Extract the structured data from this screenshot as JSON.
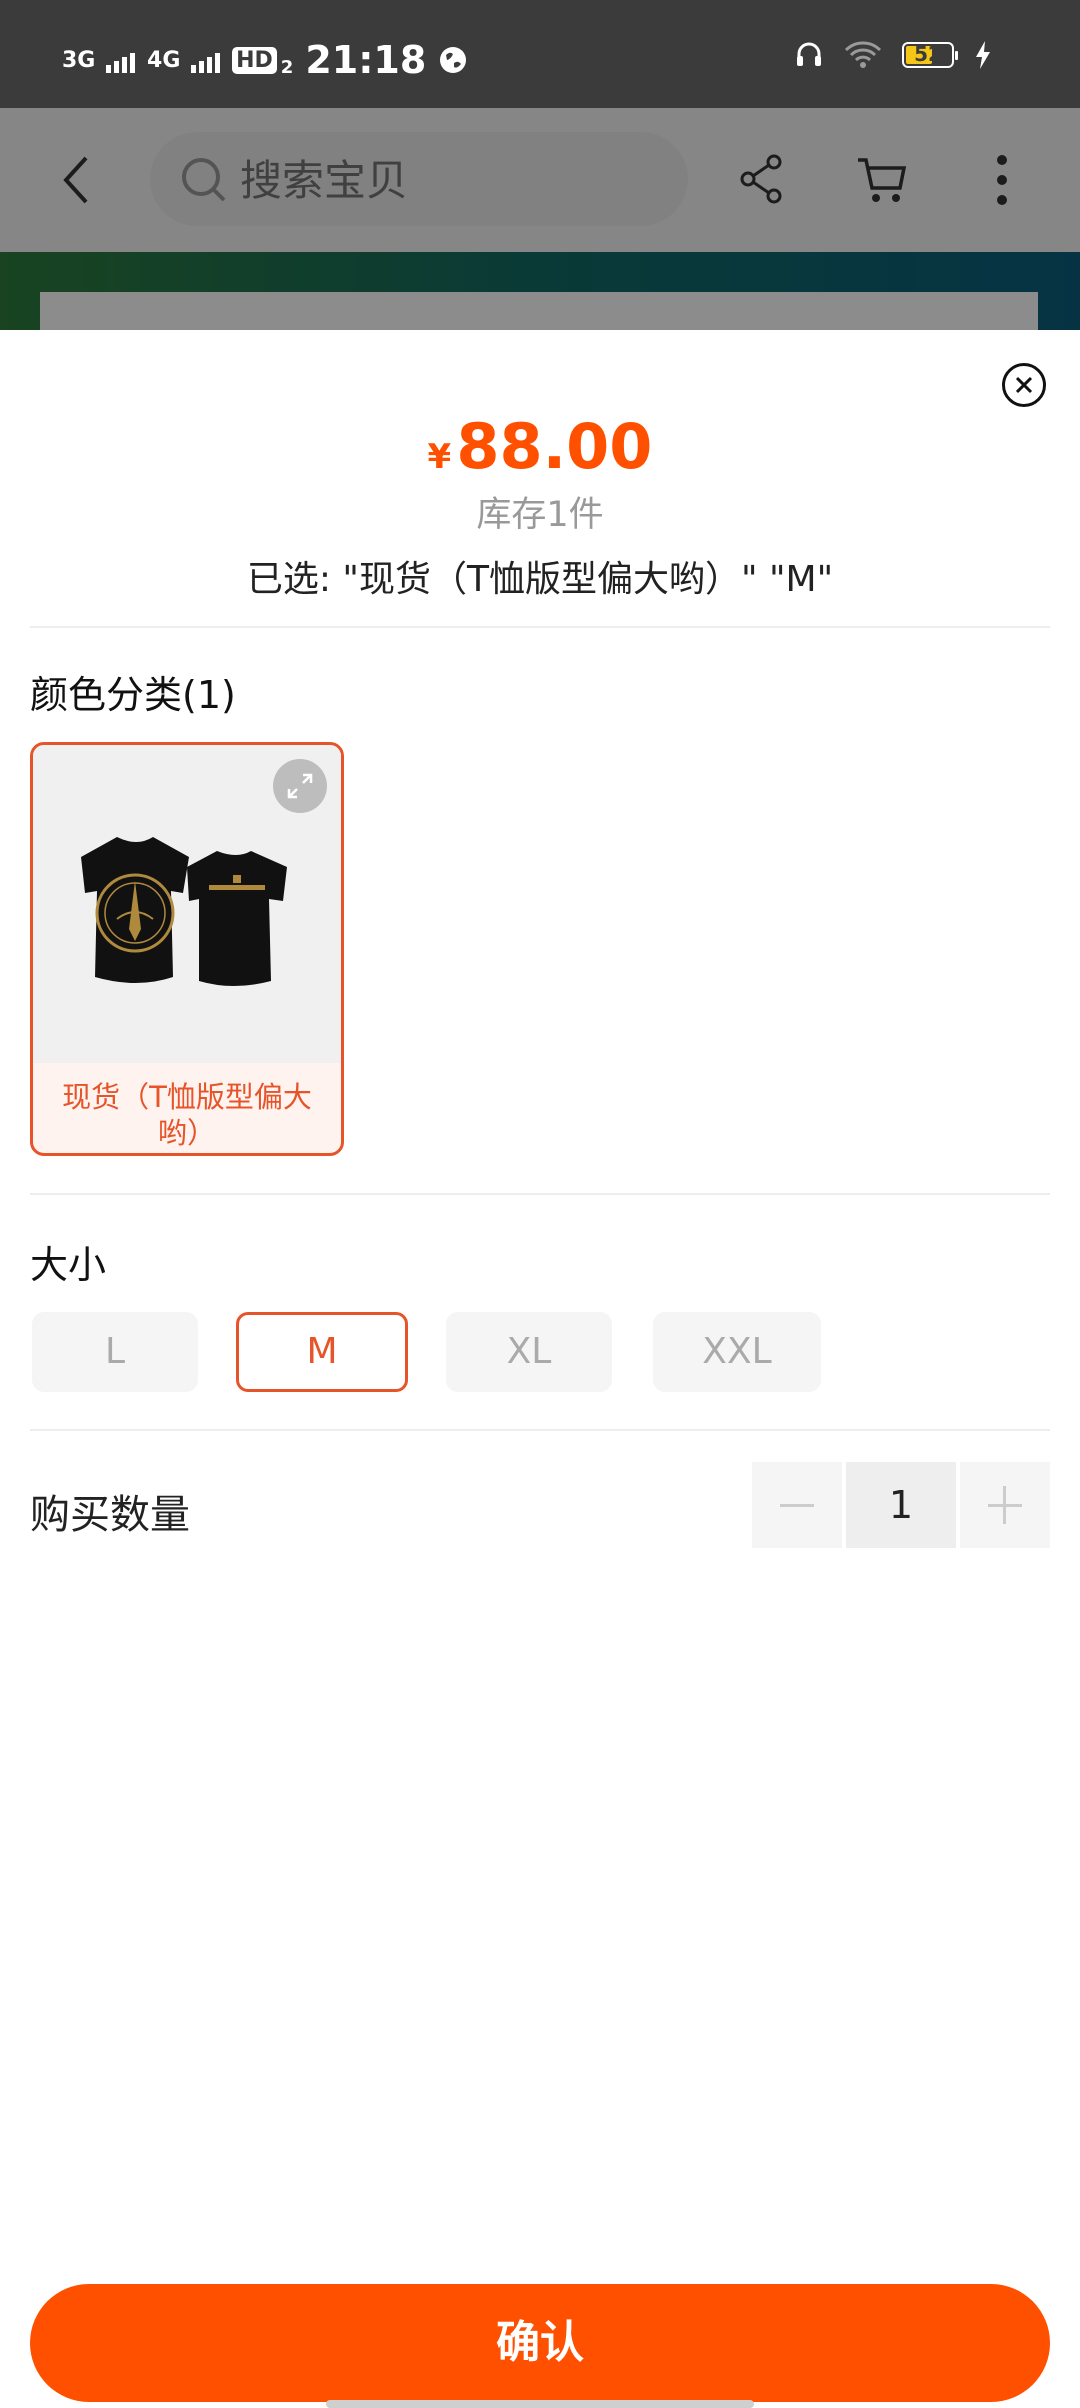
{
  "status_bar": {
    "net1": "3G",
    "net2": "4G",
    "hd": "HD",
    "hd_sub": "2",
    "time": "21:18",
    "battery_level": "52"
  },
  "header": {
    "search_placeholder": "搜索宝贝"
  },
  "sheet": {
    "currency": "¥",
    "price": "88.00",
    "stock": "库存1件",
    "selected": "已选: \"现货（T恤版型偏大哟）\" \"M\"",
    "color_section_title": "颜色分类(1)",
    "color_options": [
      {
        "label": "现货（T恤版型偏大哟）",
        "selected": true
      }
    ],
    "size_section_title": "大小",
    "sizes": [
      {
        "label": "L",
        "selected": false
      },
      {
        "label": "M",
        "selected": true
      },
      {
        "label": "XL",
        "selected": false
      },
      {
        "label": "XXL",
        "selected": false
      }
    ],
    "quantity_label": "购买数量",
    "quantity": "1",
    "confirm_label": "确认"
  },
  "colors": {
    "accent": "#ff5000",
    "selected_border": "#e8542a"
  }
}
